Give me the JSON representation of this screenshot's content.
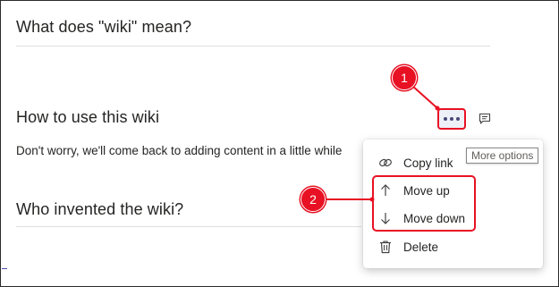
{
  "sections": [
    {
      "title": "What does \"wiki\" mean?"
    },
    {
      "title": "How to use this wiki",
      "body": "Don't worry, we'll come back to adding content in a little while"
    },
    {
      "title": "Who invented the wiki?"
    }
  ],
  "toolbar": {
    "more_options_icon": "ellipsis-icon",
    "comment_icon": "comment-icon",
    "tooltip": "More options"
  },
  "menu": {
    "items": [
      {
        "label": "Copy link",
        "icon": "link-icon"
      },
      {
        "label": "Move up",
        "icon": "arrow-up-icon"
      },
      {
        "label": "Move down",
        "icon": "arrow-down-icon"
      },
      {
        "label": "Delete",
        "icon": "trash-icon"
      }
    ]
  },
  "callouts": [
    {
      "label": "1"
    },
    {
      "label": "2"
    }
  ],
  "colors": {
    "annotation": "#e81123",
    "text": "#252423",
    "more_button_bg": "#eef0f8",
    "dots": "#464775"
  }
}
